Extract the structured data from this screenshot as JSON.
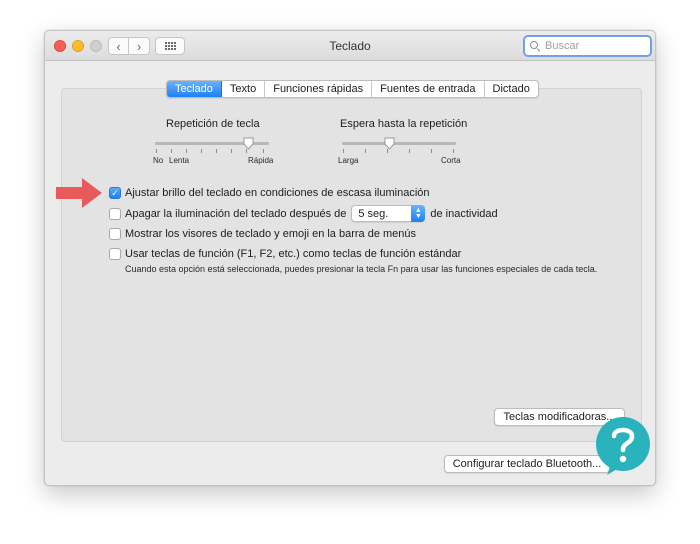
{
  "window": {
    "title": "Teclado"
  },
  "search": {
    "placeholder": "Buscar"
  },
  "tabs": [
    {
      "label": "Teclado",
      "active": true
    },
    {
      "label": "Texto"
    },
    {
      "label": "Funciones rápidas"
    },
    {
      "label": "Fuentes de entrada"
    },
    {
      "label": "Dictado"
    }
  ],
  "sliders": {
    "repeat": {
      "title": "Repetición de tecla",
      "labels": [
        "No",
        "Lenta",
        "Rápida"
      ],
      "value": "Rápida"
    },
    "delay": {
      "title": "Espera hasta la repetición",
      "labels": [
        "Larga",
        "Corta"
      ]
    }
  },
  "options": {
    "brightness": {
      "label": "Ajustar brillo del teclado en condiciones de escasa iluminación",
      "checked": true
    },
    "backlight_off": {
      "label_before": "Apagar la iluminación del teclado después de",
      "popup_value": "5 seg.",
      "label_after": "de inactividad",
      "checked": false
    },
    "show_viewers": {
      "label": "Mostrar los visores de teclado y emoji en la barra de menús",
      "checked": false
    },
    "fn_keys": {
      "label": "Usar teclas de función (F1, F2, etc.) como teclas de función estándar",
      "checked": false,
      "hint": "Cuando esta opción está seleccionada, puedes presionar la tecla Fn para usar las funciones especiales de cada tecla."
    }
  },
  "buttons": {
    "modifier_keys": "Teclas modificadoras...",
    "bluetooth": "Configurar teclado Bluetooth..."
  },
  "colors": {
    "accent": "#1b80f5",
    "arrow": "#e85b5b",
    "logo": "#2bb3bd"
  }
}
